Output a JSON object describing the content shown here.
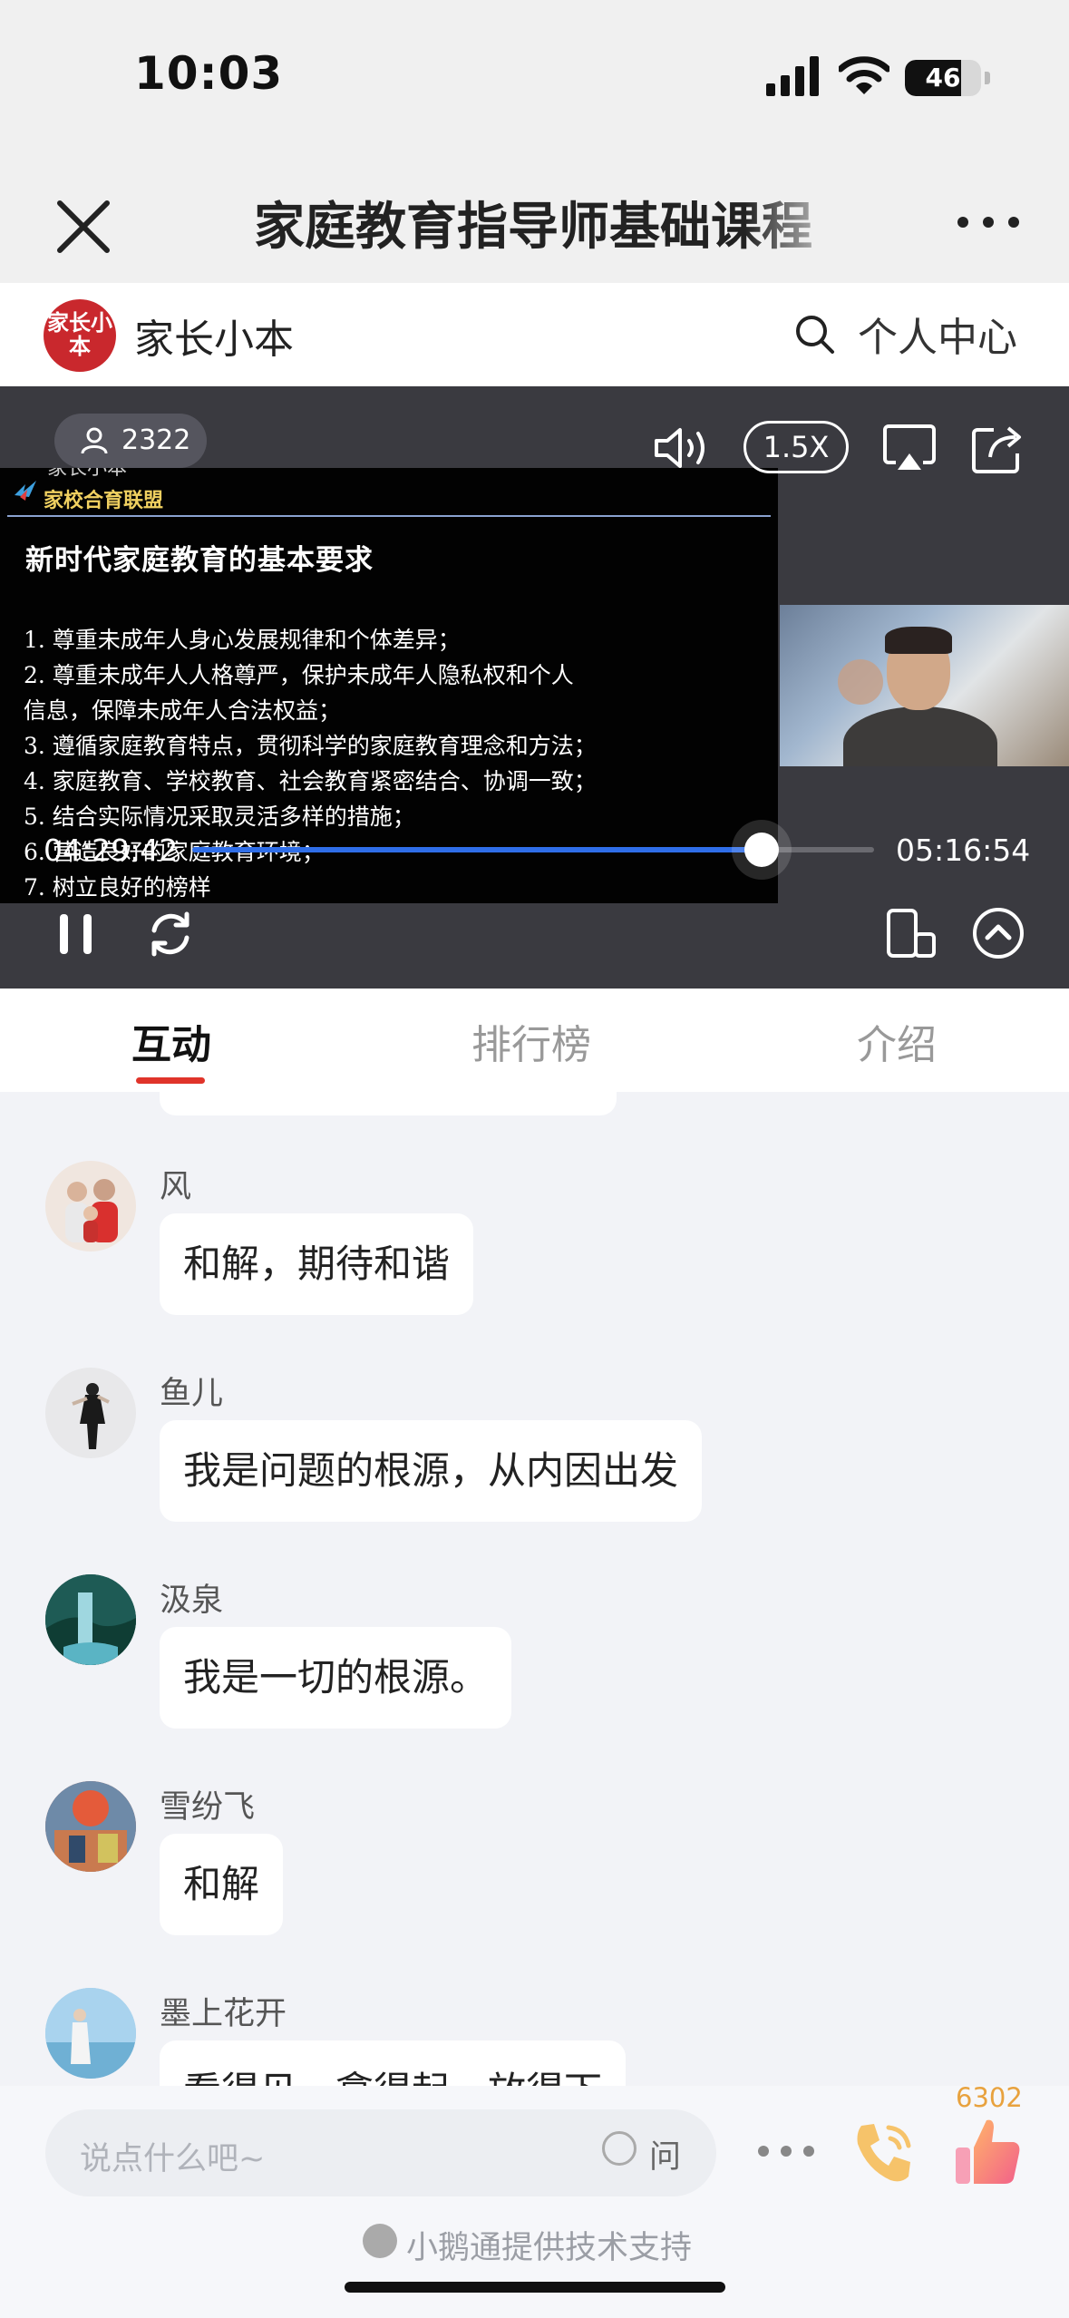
{
  "status_bar": {
    "time": "10:03",
    "battery": "46"
  },
  "nav": {
    "title": "家庭教育指导师基础课程"
  },
  "brand": {
    "logo_text": "家长小本",
    "name": "家长小本",
    "personal_center": "个人中心"
  },
  "video": {
    "viewers": "2322",
    "speed": "1.5X",
    "current_time": "04:29:42",
    "duration": "05:16:54",
    "progress": 0.835,
    "slide": {
      "watermark": "家长小本",
      "org": "家校合育联盟",
      "title": "新时代家庭教育的基本要求",
      "items": [
        "1. 尊重未成年人身心发展规律和个体差异；",
        "2. 尊重未成年人人格尊严，保护未成年人隐私权和个人",
        "信息，保障未成年人合法权益；",
        "3. 遵循家庭教育特点，贯彻科学的家庭教育理念和方法；",
        "4. 家庭教育、学校教育、社会教育紧密结合、协调一致；",
        "5. 结合实际情况采取灵活多样的措施；",
        "6. 营造良好的家庭教育环境；",
        "7. 树立良好的榜样"
      ]
    }
  },
  "tabs": [
    {
      "label": "互动",
      "active": true
    },
    {
      "label": "排行榜",
      "active": false
    },
    {
      "label": "介绍",
      "active": false
    }
  ],
  "messages": [
    {
      "user": "风",
      "text": "和解，期待和谐"
    },
    {
      "user": "鱼儿",
      "text": "我是问题的根源，从内因出发"
    },
    {
      "user": "汲泉",
      "text": "我是一切的根源。"
    },
    {
      "user": "雪纷飞",
      "text": "和解"
    },
    {
      "user": "墨上花开",
      "text": "看得见，拿得起，放得下"
    }
  ],
  "bottom": {
    "input_placeholder": "说点什么吧~",
    "ask_label": "问",
    "like_count": "6302",
    "support": "小鹅通提供技术支持"
  },
  "colors": {
    "accent": "#e0342a",
    "progress": "#2f6ee8",
    "like": "#e8a23e"
  }
}
